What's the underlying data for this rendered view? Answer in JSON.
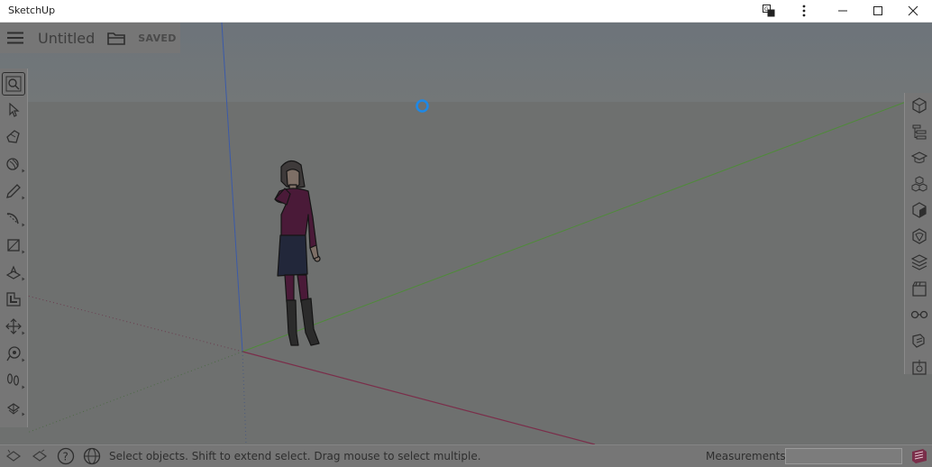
{
  "window": {
    "title": "SketchUp",
    "controls": [
      "translate-icon",
      "more-vert-icon",
      "minimize-icon",
      "maximize-icon",
      "close-icon"
    ]
  },
  "document": {
    "name": "Untitled",
    "save_state": "SAVED"
  },
  "left_toolbar": {
    "tools": [
      {
        "name": "search",
        "icon": "search-icon",
        "active": true
      },
      {
        "name": "select",
        "icon": "select-arrow-icon"
      },
      {
        "name": "eraser",
        "icon": "eraser-icon"
      },
      {
        "name": "paint-bucket",
        "icon": "paint-icon"
      },
      {
        "name": "pencil",
        "icon": "pencil-icon"
      },
      {
        "name": "arc",
        "icon": "arc-icon"
      },
      {
        "name": "rectangle",
        "icon": "rectangle-icon"
      },
      {
        "name": "push-pull",
        "icon": "push-pull-icon"
      },
      {
        "name": "offset",
        "icon": "offset-icon"
      },
      {
        "name": "move",
        "icon": "move-icon"
      },
      {
        "name": "tape-measure",
        "icon": "tape-measure-icon"
      },
      {
        "name": "walk",
        "icon": "footprints-icon"
      },
      {
        "name": "orbit",
        "icon": "orbit-icon"
      }
    ]
  },
  "right_panel": {
    "items": [
      "entity-info-icon",
      "outliner-icon",
      "instructor-icon",
      "components-icon",
      "materials-icon",
      "styles-icon",
      "layers-icon",
      "scenes-icon",
      "display-icon",
      "extensions-icon",
      "export-icon"
    ]
  },
  "status_bar": {
    "message": "Select objects. Shift to extend select. Drag mouse to select multiple.",
    "measurements_label": "Measurements",
    "measurements_value": ""
  },
  "colors": {
    "accent": "#1e88e5",
    "blue_axis": "#3b5aa8",
    "green_axis": "#4f8a3a",
    "red_axis": "#7a2e4a"
  }
}
